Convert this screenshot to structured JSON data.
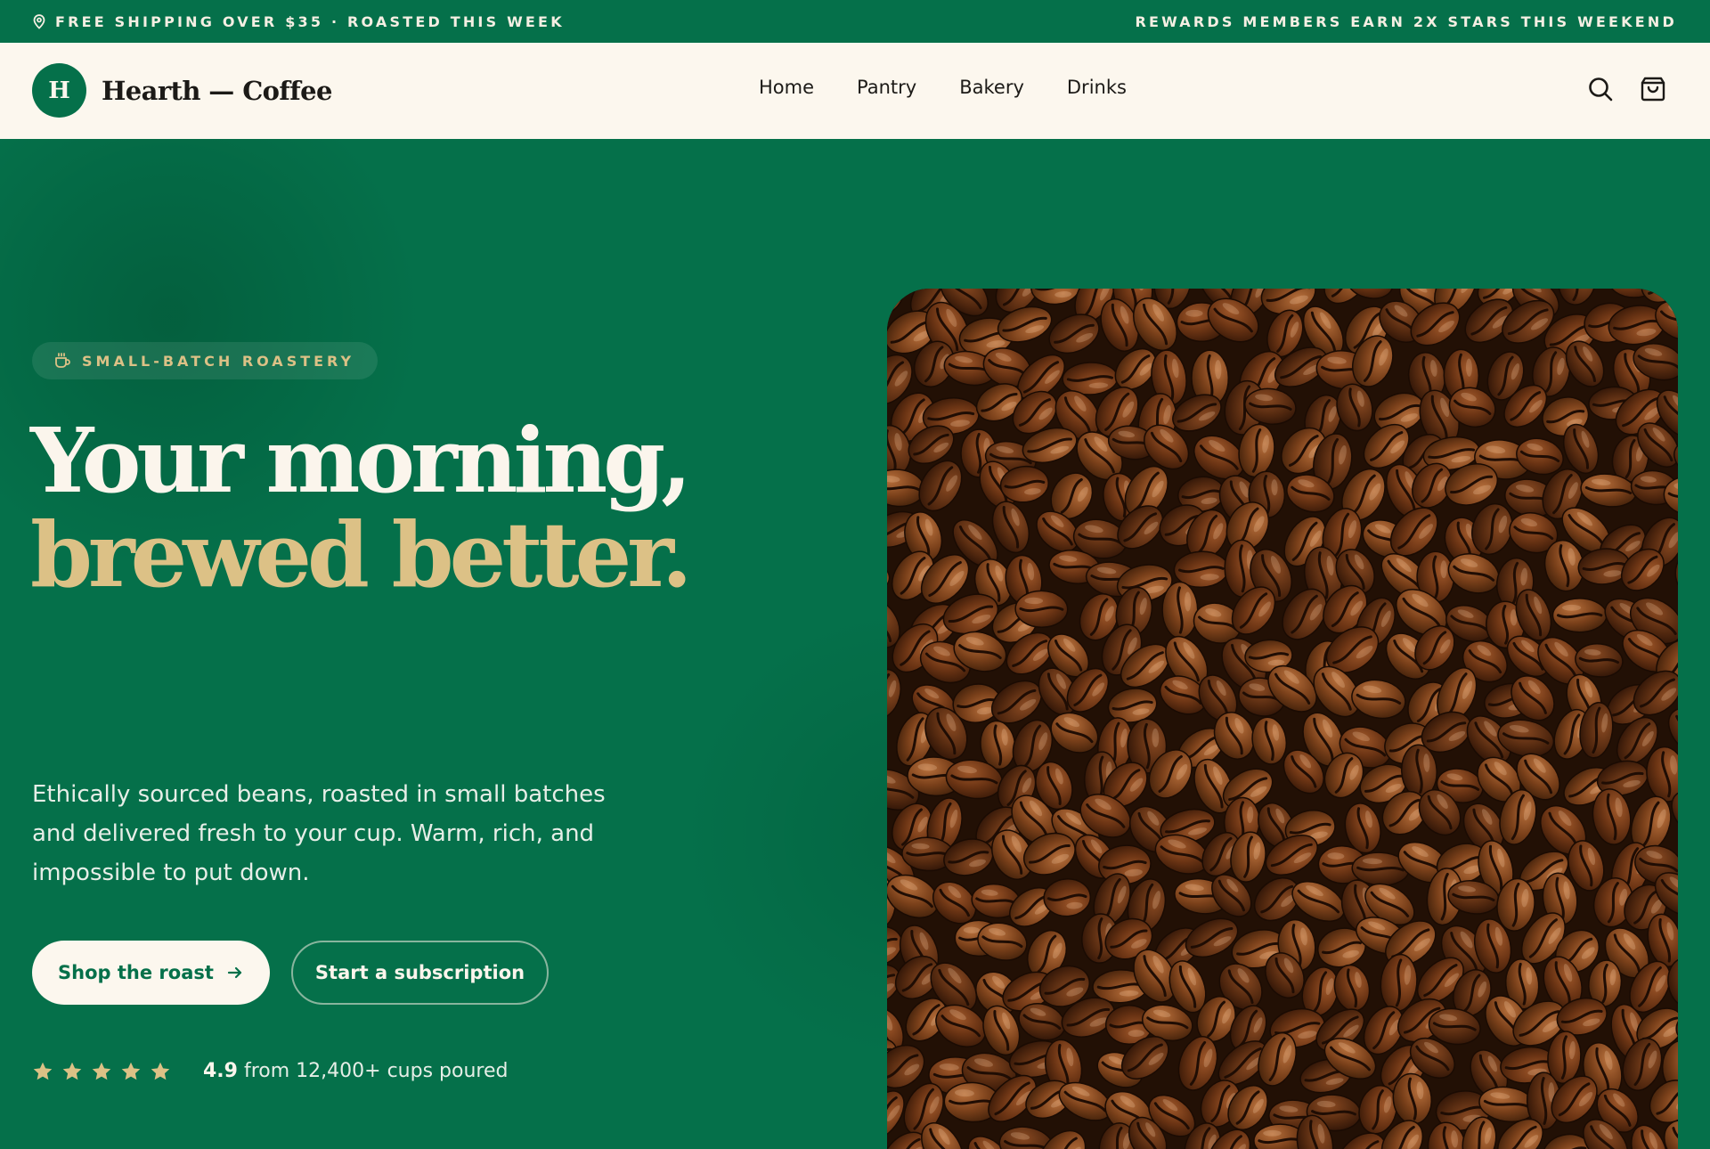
{
  "announcement": {
    "left_text": "FREE SHIPPING OVER $35 · ROASTED THIS WEEK",
    "right_text": "REWARDS MEMBERS EARN 2X STARS THIS WEEKEND",
    "left_icon": "map-pin-icon"
  },
  "brand": {
    "mark_letter": "H",
    "name": "Hearth — Coffee"
  },
  "nav": {
    "links": [
      "Home",
      "Pantry",
      "Bakery",
      "Drinks"
    ],
    "search_icon": "search-icon",
    "cart_icon": "shopping-bag-icon"
  },
  "hero": {
    "eyebrow": "SMALL-BATCH ROASTERY",
    "eyebrow_icon": "coffee-cup-icon",
    "headline_line1": "Your morning,",
    "headline_line2": "brewed better.",
    "lede": "Ethically sourced beans, roasted in small batches and delivered fresh to your cup. Warm, rich, and impossible to put down.",
    "primary_cta": "Shop the roast",
    "primary_cta_icon": "arrow-right-icon",
    "secondary_cta": "Start a subscription",
    "rating": {
      "stars": 5,
      "score": "4.9",
      "text": "from 12,400+ cups poured"
    },
    "image_subject": "roasted coffee beans"
  },
  "colors": {
    "brand_green": "#05704a",
    "cream": "#fcf7ee",
    "gold": "#dcc186",
    "ink": "#1c1a17",
    "star": "#dcc186"
  }
}
